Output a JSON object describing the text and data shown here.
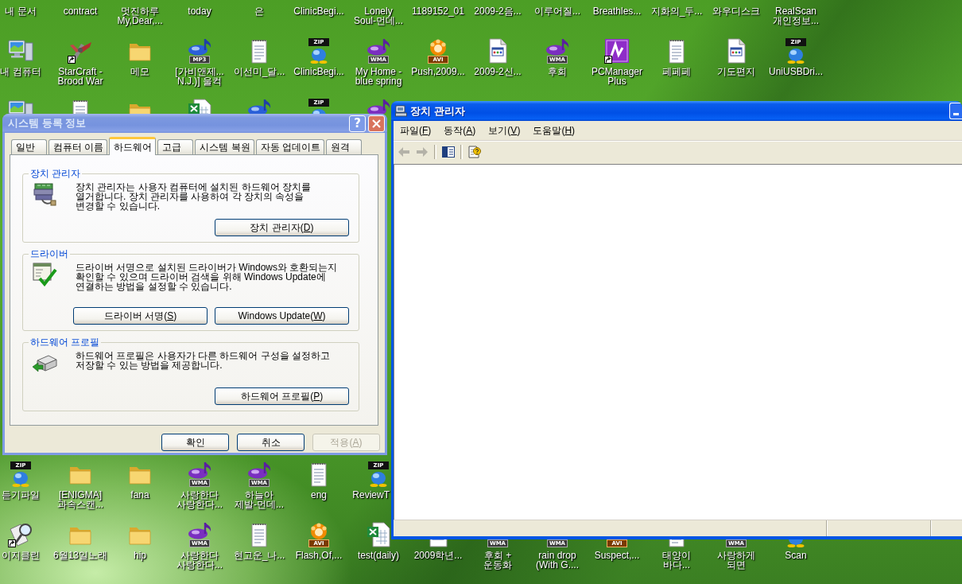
{
  "desktop": {
    "icon_rows": [
      [
        {
          "label": "내 문서"
        },
        {
          "label": "contract"
        },
        {
          "label": "멋진하루\nMy,Dear,..."
        },
        {
          "label": "today"
        },
        {
          "label": "은"
        },
        {
          "label": "ClinicBegi..."
        },
        {
          "label": "Lonely\nSoul-먼데..."
        },
        {
          "label": "1189152_01"
        },
        {
          "label": "2009-2음..."
        },
        {
          "label": "이루어질..."
        },
        {
          "label": "Breathles..."
        },
        {
          "label": "지화의_두..."
        },
        {
          "label": "와우디스크"
        },
        {
          "label": "RealScan\n개인정보..."
        }
      ],
      [
        {
          "label": "내 컴퓨터",
          "kind": "computer",
          "shortcut": false
        },
        {
          "label": "StarCraft -\nBrood War",
          "kind": "aircraft",
          "shortcut": true
        },
        {
          "label": "메모",
          "kind": "folder",
          "shortcut": false
        },
        {
          "label": "[가비앤제...\nN.J.)] 울컥",
          "kind": "mp3",
          "badge": "MP3",
          "shortcut": false
        },
        {
          "label": "이선미_달...",
          "kind": "notepad",
          "shortcut": false
        },
        {
          "label": "ClinicBegi...",
          "kind": "zip",
          "badge": "ZIP",
          "shortcut": false
        },
        {
          "label": "My Home -\nblue spring",
          "kind": "wma",
          "badge": "WMA",
          "shortcut": false
        },
        {
          "label": "Push,2009...",
          "kind": "avi",
          "badge": "AVI",
          "shortcut": false
        },
        {
          "label": "2009-2신...",
          "kind": "document",
          "shortcut": false
        },
        {
          "label": "후회",
          "kind": "wma",
          "badge": "WMA",
          "shortcut": false
        },
        {
          "label": "PCManager\nPlus",
          "kind": "app",
          "shortcut": true
        },
        {
          "label": "페페페",
          "kind": "notepad",
          "shortcut": false
        },
        {
          "label": "기도편지",
          "kind": "document",
          "shortcut": false
        },
        {
          "label": "UniUSBDri...",
          "kind": "zip",
          "badge": "ZIP",
          "shortcut": false
        }
      ],
      [
        {
          "kind": "computer"
        },
        {
          "kind": "notepad"
        },
        {
          "kind": "folder"
        },
        {
          "kind": "spreadsheet"
        },
        {
          "kind": "mp3"
        },
        {
          "kind": "zip",
          "badge": "ZIP"
        },
        {
          "kind": "wma"
        }
      ],
      [
        {
          "label": "듣기파일",
          "kind": "zip",
          "badge": "ZIP",
          "shortcut": false
        },
        {
          "label": "[ENIGMA]\n과속스캔...",
          "kind": "folder",
          "shortcut": false
        },
        {
          "label": "fana",
          "kind": "folder",
          "shortcut": false
        },
        {
          "label": "사랑한다\n사랑한다...",
          "kind": "wma",
          "badge": "WMA",
          "shortcut": false
        },
        {
          "label": "하늘아\n제발-먼데...",
          "kind": "wma",
          "badge": "WMA",
          "shortcut": false
        },
        {
          "label": "eng",
          "kind": "notepad",
          "shortcut": false
        },
        {
          "label": "ReviewT",
          "kind": "zip",
          "badge": "ZIP",
          "shortcut": false
        }
      ],
      [
        {
          "label": "이지클린",
          "kind": "magnifier",
          "shortcut": true
        },
        {
          "label": "6월13일노래",
          "kind": "folder",
          "shortcut": false
        },
        {
          "label": "hip",
          "kind": "folder",
          "shortcut": false
        },
        {
          "label": "사랑한다\n사랑한다...",
          "kind": "wma",
          "badge": "WMA",
          "shortcut": false
        },
        {
          "label": "현고운_나...",
          "kind": "notepad",
          "shortcut": false
        },
        {
          "label": "Flash,Of,...",
          "kind": "avi",
          "badge": "AVI",
          "shortcut": false
        },
        {
          "label": "test(daily)",
          "kind": "spreadsheet",
          "shortcut": false
        },
        {
          "label": "2009학년...",
          "kind": "document",
          "shortcut": false
        },
        {
          "label": "후회 +\n운동화",
          "kind": "wma",
          "badge": "WMA",
          "shortcut": false
        },
        {
          "label": "rain drop\n(With G....",
          "kind": "wma",
          "badge": "WMA",
          "shortcut": false
        },
        {
          "label": "Suspect,...",
          "kind": "avi",
          "badge": "AVI",
          "shortcut": false
        },
        {
          "label": "태양이\n바다...",
          "kind": "notepad",
          "shortcut": false
        },
        {
          "label": "사랑하게\n되면",
          "kind": "wma",
          "badge": "WMA",
          "shortcut": false
        },
        {
          "label": "Scan",
          "kind": "zip",
          "shortcut": false
        }
      ]
    ]
  },
  "system_properties": {
    "title": "시스템 등록 정보",
    "active": false,
    "help_button": "?",
    "tabs": [
      {
        "label": "일반",
        "selected": false
      },
      {
        "label": "컴퓨터 이름",
        "selected": false
      },
      {
        "label": "하드웨어",
        "selected": true
      },
      {
        "label": "고급",
        "selected": false
      },
      {
        "label": "시스템 복원",
        "selected": false
      },
      {
        "label": "자동 업데이트",
        "selected": false
      },
      {
        "label": "원격",
        "selected": false
      }
    ],
    "groups": [
      {
        "title": "장치 관리자",
        "kind": "device-manager",
        "description": "장치 관리자는 사용자 컴퓨터에 설치된 하드웨어 장치를\n열거합니다. 장치 관리자를 사용하여 각 장치의 속성을\n변경할 수 있습니다.",
        "buttons": [
          {
            "label": [
              "장치 관리자(",
              "D",
              ")"
            ],
            "disabled": false
          }
        ]
      },
      {
        "title": "드라이버",
        "kind": "driver-signing",
        "description": "드라이버 서명으로 설치된 드라이버가 Windows와 호환되는지\n확인할 수 있으며 드라이버 검색을 위해 Windows Update에\n연결하는 방법을 설정할 수 있습니다.",
        "buttons": [
          {
            "label": [
              "드라이버 서명(",
              "S",
              ")"
            ],
            "disabled": false
          },
          {
            "label": [
              "Windows Update(",
              "W",
              ")"
            ],
            "disabled": false
          }
        ]
      },
      {
        "title": "하드웨어 프로필",
        "kind": "hardware-profile",
        "description": "하드웨어 프로필은 사용자가 다른 하드웨어 구성을 설정하고\n저장할 수 있는 방법을 제공합니다.",
        "buttons": [
          {
            "label": [
              "하드웨어 프로필(",
              "P",
              ")"
            ],
            "disabled": false
          }
        ]
      }
    ],
    "buttons": [
      {
        "label": [
          "확인"
        ],
        "disabled": false
      },
      {
        "label": [
          "취소"
        ],
        "disabled": false
      },
      {
        "label": [
          "적용(",
          "A",
          ")"
        ],
        "disabled": true
      }
    ]
  },
  "device_manager": {
    "title": "장치 관리자",
    "active": true,
    "menu": [
      {
        "label": [
          "파일(",
          "F",
          ")"
        ]
      },
      {
        "label": [
          "동작(",
          "A",
          ")"
        ]
      },
      {
        "label": [
          "보기(",
          "V",
          ")"
        ]
      },
      {
        "label": [
          "도움말(",
          "H",
          ")"
        ]
      }
    ],
    "toolbar": [
      [
        {
          "kind": "back",
          "disabled": true
        },
        {
          "kind": "forward",
          "disabled": true
        }
      ],
      [
        {
          "kind": "console-tree",
          "disabled": false
        }
      ],
      [
        {
          "kind": "help",
          "disabled": false
        }
      ]
    ]
  }
}
